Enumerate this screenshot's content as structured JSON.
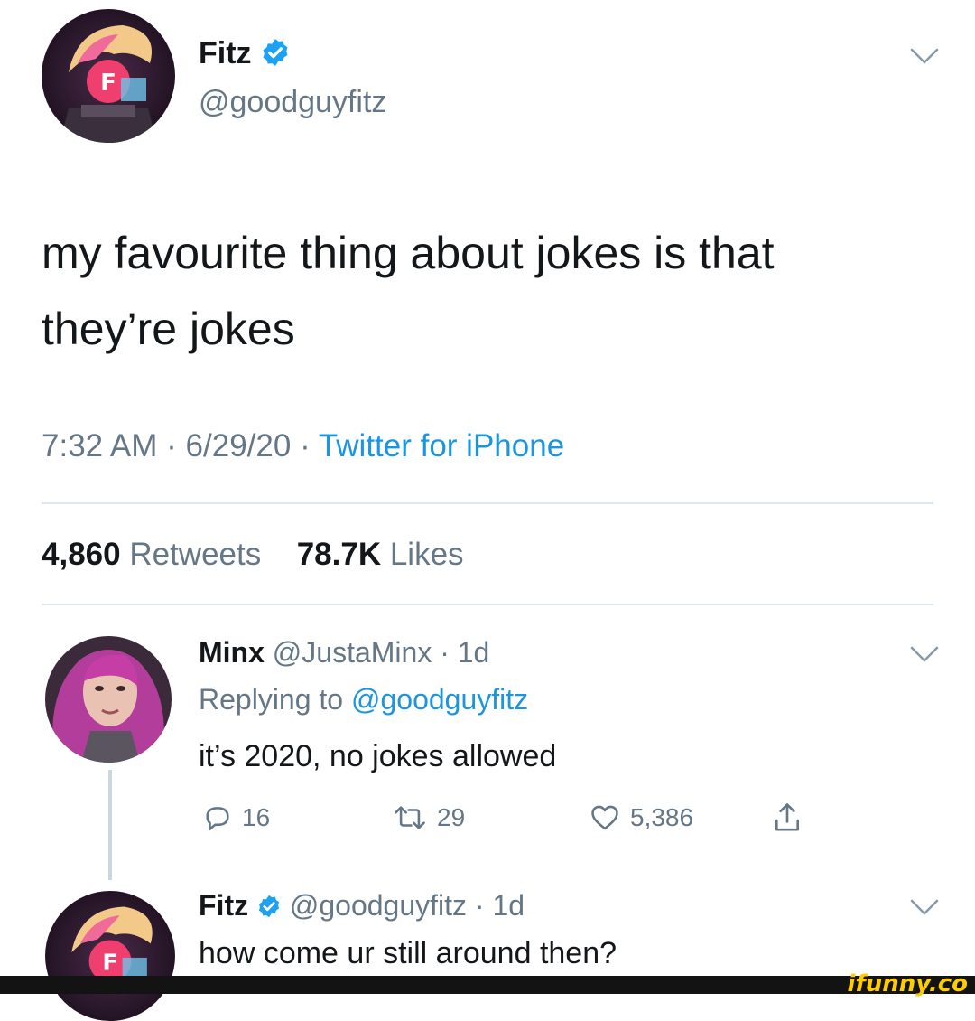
{
  "tweet": {
    "author_name": "Fitz",
    "author_handle": "@goodguyfitz",
    "text_line1": "my favourite thing about jokes is that",
    "text_line2": "they’re jokes",
    "time": "7:32 AM",
    "date": "6/29/20",
    "source": "Twitter for iPhone",
    "retweets_count": "4,860",
    "retweets_label": "Retweets",
    "likes_count": "78.7K",
    "likes_label": "Likes"
  },
  "reply1": {
    "author_name": "Minx",
    "author_handle": "@JustaMinx",
    "age": "1d",
    "replying_prefix": "Replying to",
    "replying_handle": "@goodguyfitz",
    "text": "it’s 2020, no jokes allowed",
    "reply_count": "16",
    "retweet_count": "29",
    "like_count": "5,386"
  },
  "reply2": {
    "author_name": "Fitz",
    "author_handle": "@goodguyfitz",
    "age": "1d",
    "text": "how come ur still around then?"
  },
  "watermark": "ifunny.co",
  "colors": {
    "text": "#14171a",
    "muted": "#657786",
    "link": "#1b95e0",
    "divider": "#e1e8ed",
    "verified": "#1da1f2",
    "watermark_bar": "#131313",
    "watermark_text": "#ffcc00"
  },
  "icons": [
    "chevron-down-icon",
    "verified-badge-icon",
    "reply-icon",
    "retweet-icon",
    "like-icon",
    "share-icon"
  ]
}
